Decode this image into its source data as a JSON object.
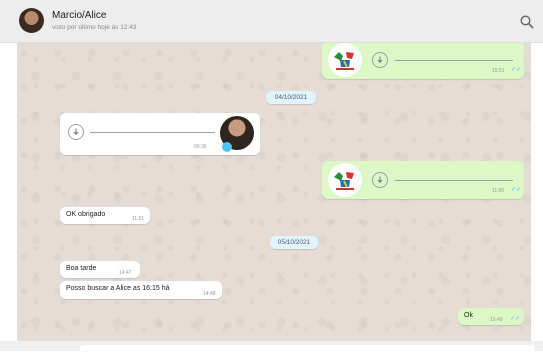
{
  "header": {
    "contact_name": "Marcio/Alice",
    "status": "visto por último hoje às 12:43"
  },
  "icons": {
    "search": "search-icon",
    "download": "download-icon",
    "double_check": "double-check-icon"
  },
  "colors": {
    "outgoing_bubble": "#dcf8c6",
    "incoming_bubble": "#ffffff",
    "date_badge": "#e1f3fb",
    "chat_background": "#e5ddd5",
    "read_ticks": "#4fc3f7"
  },
  "messages": [
    {
      "type": "audio",
      "direction": "out",
      "time": "15:51"
    },
    {
      "type": "date",
      "text": "04/10/2021"
    },
    {
      "type": "audio",
      "direction": "in",
      "time": "09:36"
    },
    {
      "type": "audio",
      "direction": "out",
      "time": "11:00"
    },
    {
      "type": "text",
      "direction": "in",
      "text": "OK obrigado",
      "time": "11:01"
    },
    {
      "type": "date",
      "text": "05/10/2021"
    },
    {
      "type": "text",
      "direction": "in",
      "text": "Boa tarde",
      "time": "14:47"
    },
    {
      "type": "text",
      "direction": "in",
      "text": "Posso buscar a Alice as 16:15 há",
      "time": "14:48"
    },
    {
      "type": "text",
      "direction": "out",
      "text": "Ok",
      "time": "15:49"
    }
  ]
}
